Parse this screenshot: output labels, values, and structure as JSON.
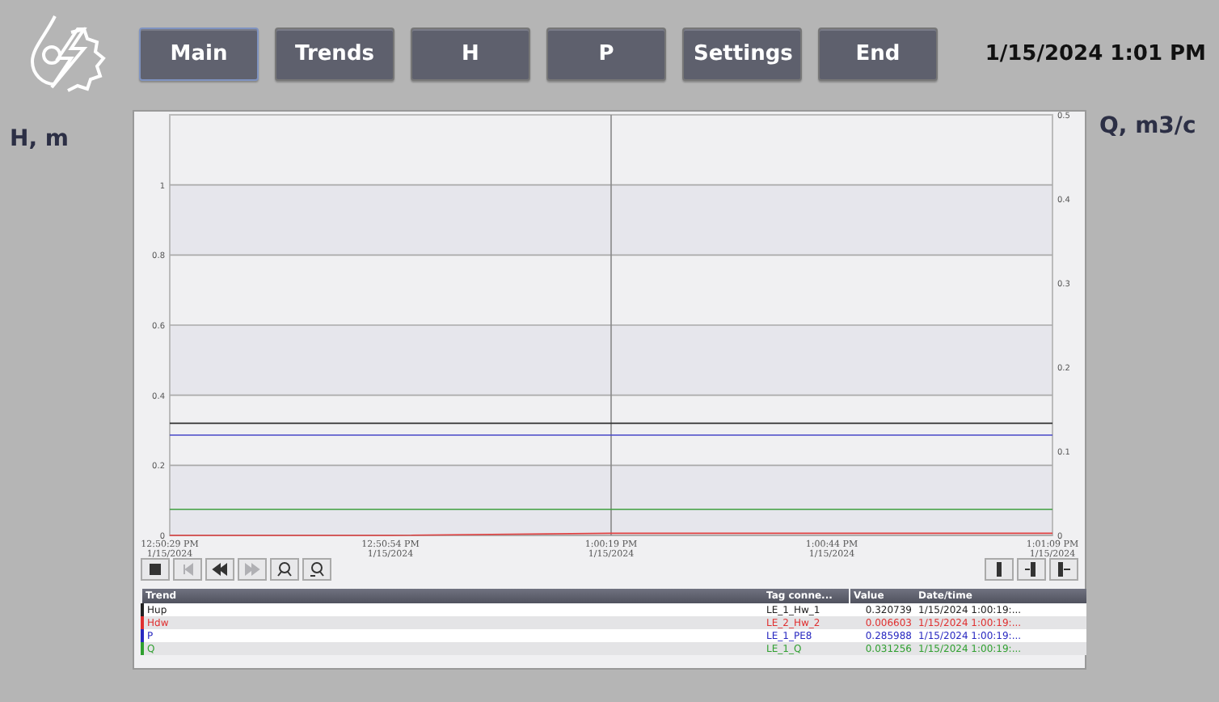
{
  "nav": [
    {
      "label": "Main",
      "selected": true
    },
    {
      "label": "Trends",
      "selected": false
    },
    {
      "label": "H",
      "selected": false
    },
    {
      "label": "P",
      "selected": false
    },
    {
      "label": "Settings",
      "selected": false
    },
    {
      "label": "End",
      "selected": false
    }
  ],
  "clock": "1/15/2024 1:01 PM",
  "left_axis_title": "H, m",
  "right_axis_title": "Q, m3/c",
  "trend": {
    "chart_data": {
      "type": "line",
      "categories": [
        "12:50:29 PM\n1/15/2024",
        "12:50:54 PM\n1/15/2024",
        "1:00:19 PM\n1/15/2024",
        "1:00:44 PM\n1/15/2024",
        "1:01:09 PM\n1/15/2024"
      ],
      "grid": true,
      "ref_lines": [
        {
          "axis": "x",
          "value": "1:00:19 PM\n1/15/2024"
        }
      ],
      "ylim": [
        0,
        1.2
      ],
      "yticks": [
        0,
        0.2,
        0.4,
        0.6,
        0.8,
        1
      ],
      "y2lim": [
        0,
        0.5
      ],
      "y2ticks": [
        0,
        0.1,
        0.2,
        0.3,
        0.4,
        0.5
      ],
      "series": [
        {
          "name": "Hup",
          "color": "#333333",
          "values": [
            0.32,
            0.32,
            0.32,
            0.32,
            0.32
          ]
        },
        {
          "name": "Hdw",
          "color": "#e04040",
          "values": [
            0,
            0,
            0.006,
            0.006,
            0.006
          ]
        },
        {
          "name": "P",
          "color": "#4848c8",
          "values": [
            0.286,
            0.286,
            0.286,
            0.286,
            0.286
          ]
        },
        {
          "name": "Q",
          "color": "#40a040",
          "axis": "y2",
          "values": [
            0.031,
            0.031,
            0.031,
            0.031,
            0.031
          ]
        }
      ]
    },
    "toolbar_left": [
      {
        "kind": "stop",
        "disabled": false
      },
      {
        "kind": "first",
        "disabled": true
      },
      {
        "kind": "back",
        "disabled": false
      },
      {
        "kind": "forward",
        "disabled": true
      },
      {
        "kind": "zoom-in",
        "disabled": false
      },
      {
        "kind": "zoom-out",
        "disabled": false
      }
    ],
    "toolbar_right": [
      {
        "kind": "ruler",
        "disabled": false
      },
      {
        "kind": "ruler-left",
        "disabled": false
      },
      {
        "kind": "ruler-right",
        "disabled": false
      }
    ],
    "table": {
      "columns": [
        "Trend",
        "Tag conne...",
        "Value",
        "Date/time"
      ],
      "rows": [
        {
          "tag": "LE_1_Hw_1",
          "value": "0.320739",
          "datetime": "1/15/2024 1:00:19:...",
          "color": "#222222"
        },
        {
          "tag": "LE_2_Hw_2",
          "value": "0.006603",
          "datetime": "1/15/2024 1:00:19:...",
          "color": "#e03030"
        },
        {
          "tag": "LE_1_PE8",
          "value": "0.285988",
          "datetime": "1/15/2024 1:00:19:...",
          "color": "#2828c0"
        },
        {
          "tag": "LE_1_Q",
          "value": "0.031256",
          "datetime": "1/15/2024 1:00:19:...",
          "color": "#30a030"
        }
      ]
    }
  }
}
